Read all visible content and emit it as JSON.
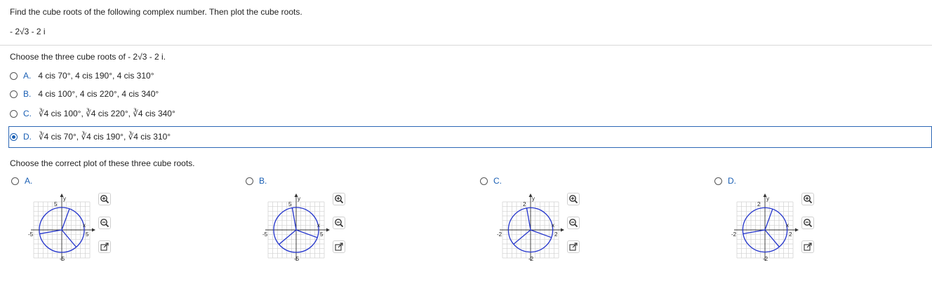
{
  "question": {
    "instruction": "Find the cube roots of the following complex number. Then plot the cube roots.",
    "expression": "- 2√3 - 2 i"
  },
  "part1": {
    "prompt": "Choose the three cube roots of  - 2√3 - 2 i.",
    "options": [
      {
        "letter": "A.",
        "text": "4 cis 70°, 4 cis 190°, 4 cis 310°",
        "selected": false
      },
      {
        "letter": "B.",
        "text": "4 cis 100°, 4 cis 220°, 4 cis 340°",
        "selected": false
      },
      {
        "letter": "C.",
        "text": "∛4 cis 100°, ∛4 cis 220°, ∛4 cis 340°",
        "selected": false
      },
      {
        "letter": "D.",
        "text": "∛4 cis 70°, ∛4 cis 190°, ∛4 cis 310°",
        "selected": true
      }
    ]
  },
  "part2": {
    "prompt": "Choose the correct plot of these three cube roots.",
    "plots": [
      {
        "letter": "A.",
        "axis_max": "5",
        "axis_min": "-5",
        "angles": [
          70,
          190,
          310
        ],
        "radius_frac": 0.8
      },
      {
        "letter": "B.",
        "axis_max": "5",
        "axis_min": "-5",
        "angles": [
          100,
          220,
          340
        ],
        "radius_frac": 0.8
      },
      {
        "letter": "C.",
        "axis_max": "2",
        "axis_min": "-2",
        "angles": [
          100,
          220,
          340
        ],
        "radius_frac": 0.79
      },
      {
        "letter": "D.",
        "axis_max": "2",
        "axis_min": "-2",
        "angles": [
          70,
          190,
          310
        ],
        "radius_frac": 0.79
      }
    ],
    "axis_x_label": "x",
    "axis_y_label": "y"
  },
  "colors": {
    "accent": "#1a5fb4",
    "circle": "#2233cc",
    "grid": "#d0d0d0"
  },
  "icons": {
    "zoom_in": "zoom-in-icon",
    "zoom_out": "zoom-out-icon",
    "popout": "popout-icon"
  }
}
